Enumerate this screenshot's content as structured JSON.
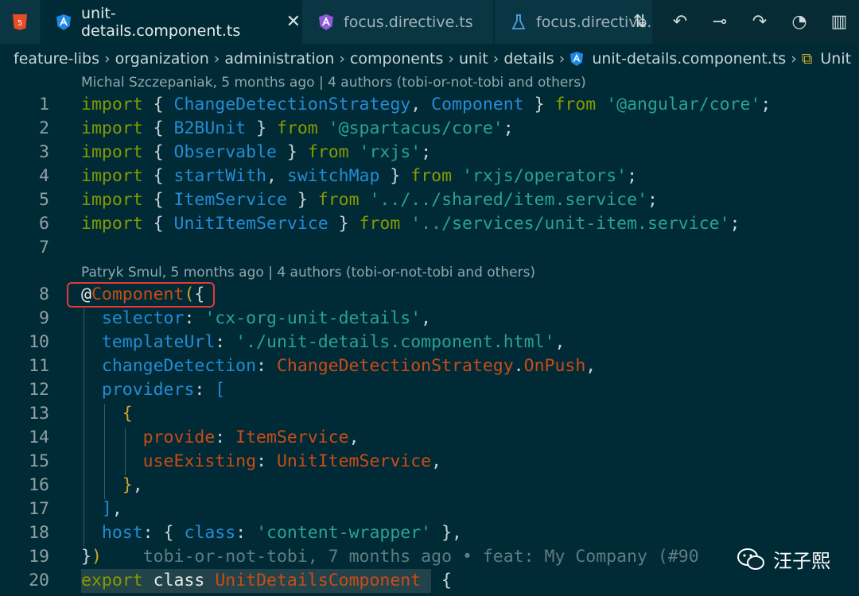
{
  "tabs": [
    {
      "label": "unit-details.component.ts",
      "icon": "angular-icon",
      "active": true
    },
    {
      "label": "focus.directive.ts",
      "icon": "angular-icon"
    },
    {
      "label": "focus.directive.",
      "icon": "flask-icon"
    }
  ],
  "breadcrumb": [
    "feature-libs",
    "organization",
    "administration",
    "components",
    "unit",
    "details",
    "unit-details.component.ts",
    "Unit"
  ],
  "blame": [
    "Michal Szczepaniak, 5 months ago | 4 authors (tobi-or-not-tobi and others)",
    "Patryk Smul, 5 months ago | 4 authors (tobi-or-not-tobi and others)"
  ],
  "lines": {
    "n1": "1",
    "n2": "2",
    "n3": "3",
    "n4": "4",
    "n5": "5",
    "n6": "6",
    "n7": "7",
    "n8": "8",
    "n9": "9",
    "n10": "10",
    "n11": "11",
    "n12": "12",
    "n13": "13",
    "n14": "14",
    "n15": "15",
    "n16": "16",
    "n17": "17",
    "n18": "18",
    "n19": "19",
    "n20": "20"
  },
  "code": {
    "import": "import",
    "from": "from",
    "l1_a": "ChangeDetectionStrategy",
    "l1_b": "Component",
    "l1_mod": "'@angular/core'",
    "l2_a": "B2BUnit",
    "l2_mod": "'@spartacus/core'",
    "l3_a": "Observable",
    "l3_mod": "'rxjs'",
    "l4_a": "startWith",
    "l4_b": "switchMap",
    "l4_mod": "'rxjs/operators'",
    "l5_a": "ItemService",
    "l5_mod": "'../../shared/item.service'",
    "l6_a": "UnitItemService",
    "l6_mod": "'../services/unit-item.service'",
    "l8_dec": "Component",
    "l9_key": "selector",
    "l9_val": "'cx-org-unit-details'",
    "l10_key": "templateUrl",
    "l10_val": "'./unit-details.component.html'",
    "l11_key": "changeDetection",
    "l11_a": "ChangeDetectionStrategy",
    "l11_b": "OnPush",
    "l12_key": "providers",
    "l14_key": "provide",
    "l14_val": "ItemService",
    "l15_key": "useExisting",
    "l15_val": "UnitItemService",
    "l18_key": "host",
    "l18_k2": "class",
    "l18_val": "'content-wrapper'",
    "l19_ghost": "tobi-or-not-tobi, 7 months ago • feat: My Company (#90",
    "l20_export": "export",
    "l20_class": "class",
    "l20_name": "UnitDetailsComponent"
  },
  "watermark": "汪子熙",
  "colors": {
    "background": "#002B36",
    "keyword": "#859900",
    "identifier": "#268BD2",
    "string": "#2AA198",
    "property": "#CB4B16",
    "highlight_box": "#E53935"
  }
}
